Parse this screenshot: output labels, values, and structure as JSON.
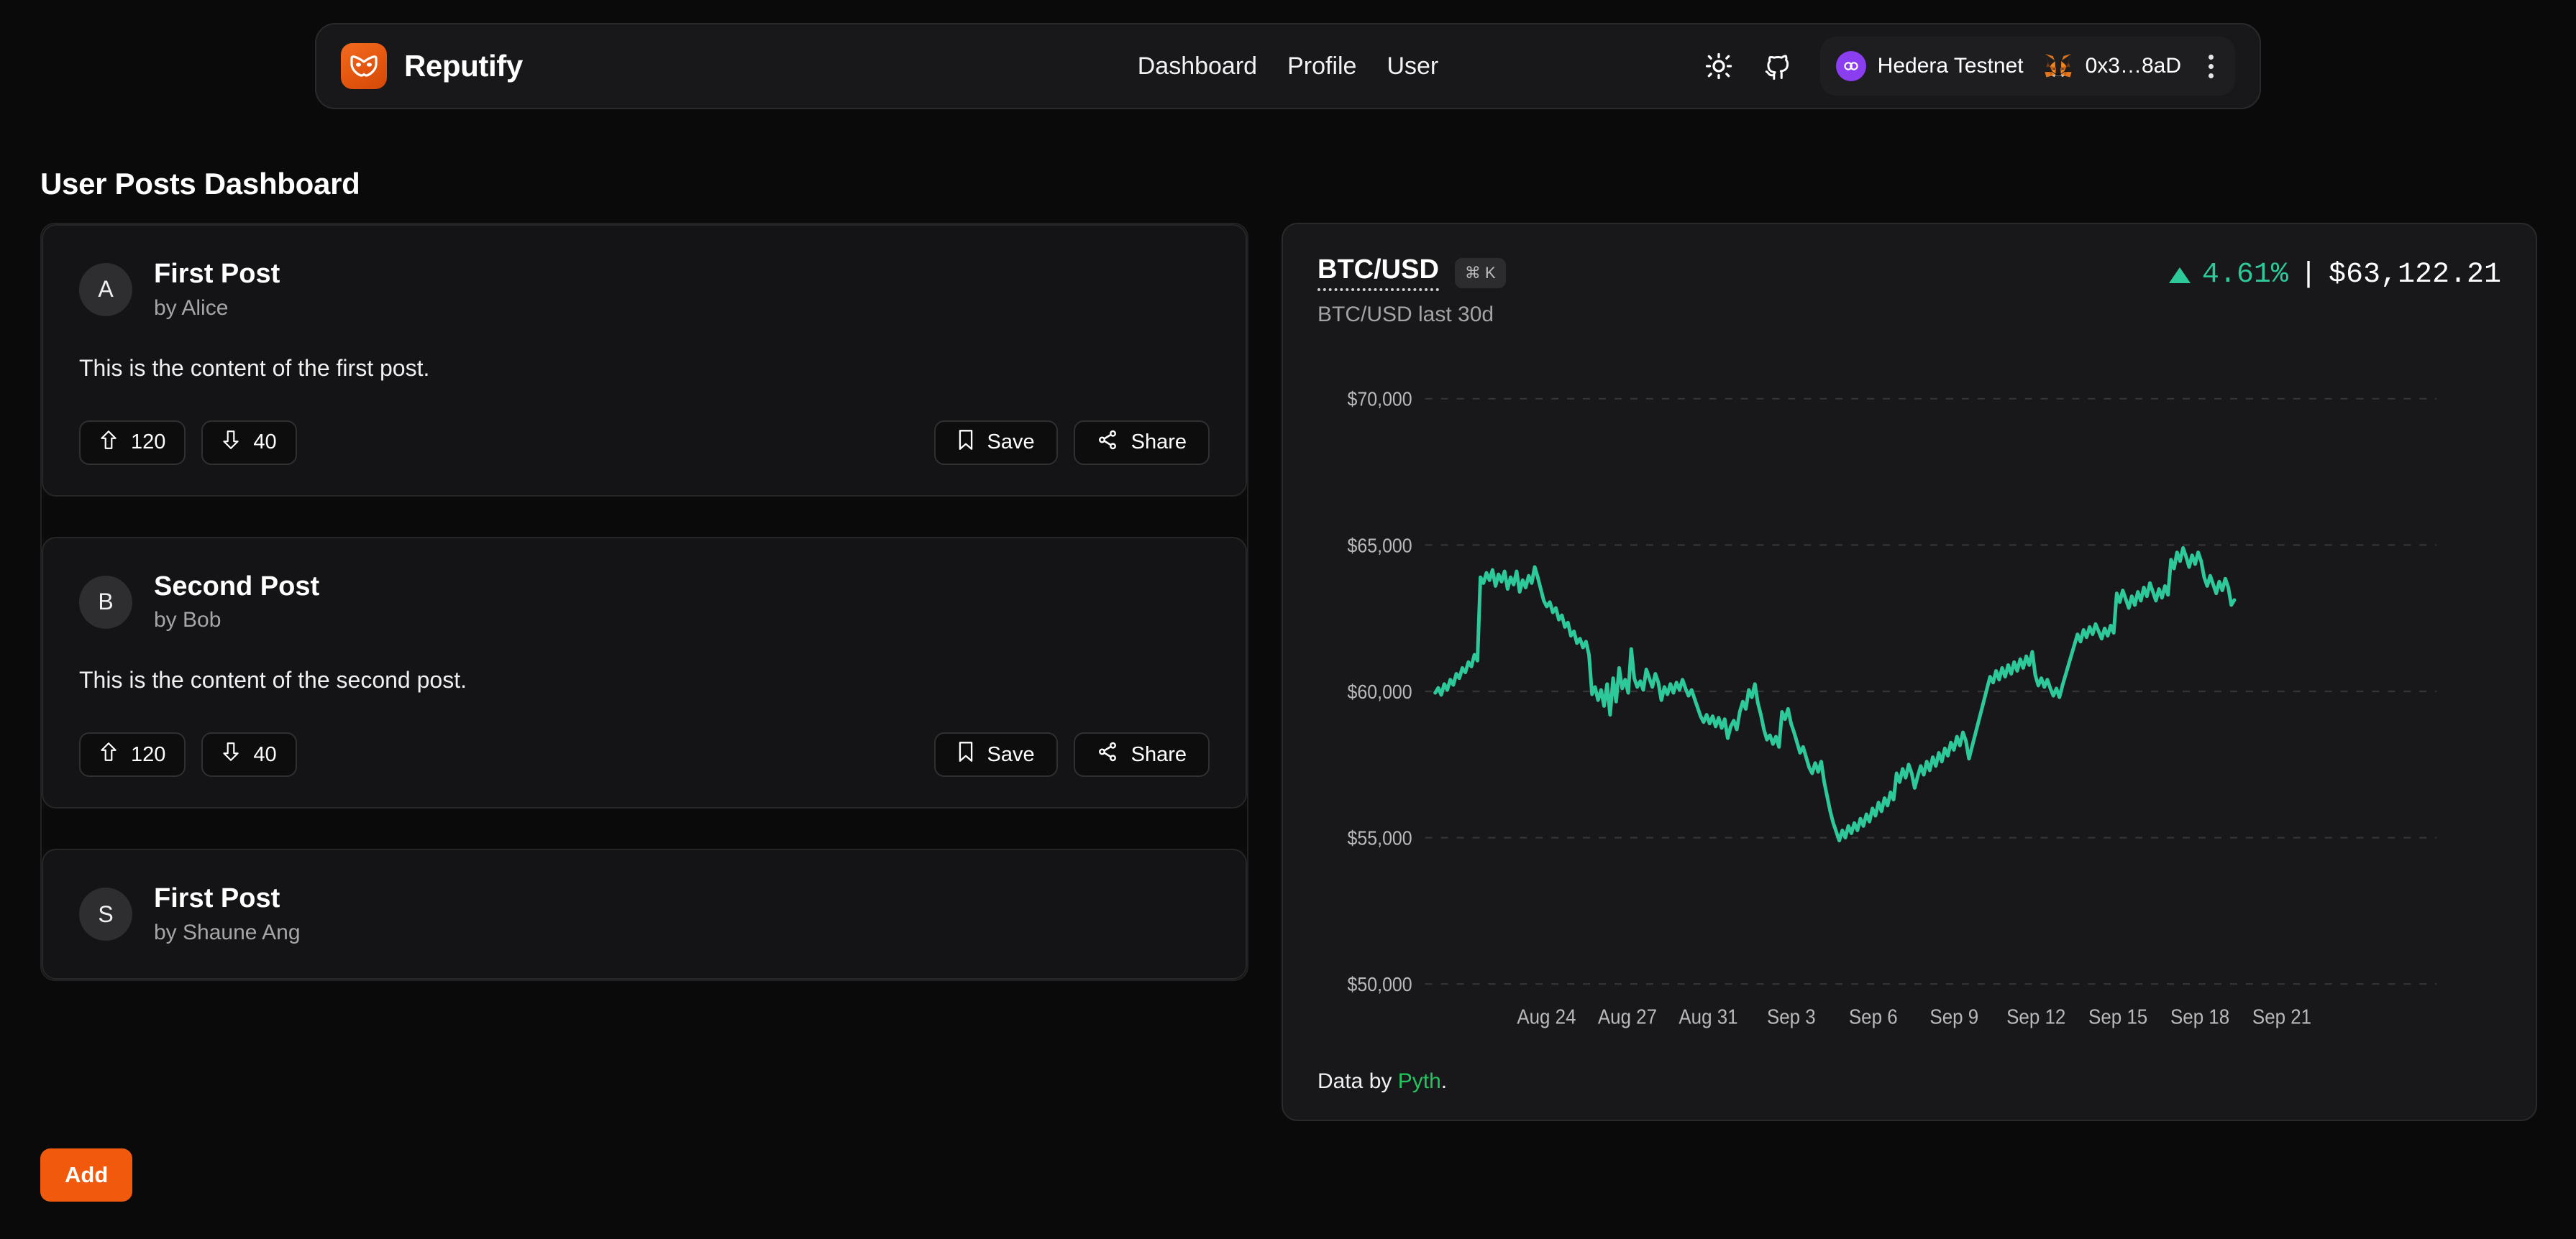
{
  "header": {
    "brand": "Reputify",
    "logo_icon": "mask-icon",
    "nav": [
      {
        "label": "Dashboard"
      },
      {
        "label": "Profile"
      },
      {
        "label": "User"
      }
    ],
    "theme_toggle_icon": "sun-icon",
    "github_icon": "github-icon",
    "network": {
      "label": "Hedera Testnet",
      "icon": "hedera-icon",
      "color": "#8b3df0"
    },
    "wallet": {
      "label": "0x3…8aD",
      "icon": "metamask-fox-icon"
    },
    "menu_icon": "kebab-menu-icon"
  },
  "main": {
    "title": "User Posts Dashboard",
    "add_button": "Add",
    "posts": [
      {
        "avatar": "A",
        "title": "First Post",
        "author": "by Alice",
        "content": "This is the content of the first post.",
        "upvotes": "120",
        "downvotes": "40",
        "save_label": "Save",
        "share_label": "Share"
      },
      {
        "avatar": "B",
        "title": "Second Post",
        "author": "by Bob",
        "content": "This is the content of the second post.",
        "upvotes": "120",
        "downvotes": "40",
        "save_label": "Save",
        "share_label": "Share"
      },
      {
        "avatar": "S",
        "title": "First Post",
        "author": "by Shaune Ang"
      }
    ]
  },
  "chart_panel": {
    "symbol": "BTC/USD",
    "shortcut": "⌘ K",
    "subtitle": "BTC/USD last 30d",
    "change_pct": "4.61%",
    "separator": "|",
    "price": "$63,122.21",
    "footer_prefix": "Data by ",
    "footer_link": "Pyth",
    "footer_suffix": ".",
    "up_color": "#2ec99a",
    "link_color": "#22c55e"
  },
  "chart_data": {
    "type": "line",
    "title": "BTC/USD last 30d",
    "xlabel": "",
    "ylabel": "",
    "ylim": [
      50000,
      71000
    ],
    "grid": true,
    "legend": false,
    "line_color": "#2ec99a",
    "ytick_labels": [
      "$70,000",
      "$65,000",
      "$60,000",
      "$55,000",
      "$50,000"
    ],
    "ytick_values": [
      70000,
      65000,
      60000,
      55000,
      50000
    ],
    "xtick_labels": [
      "Aug 24",
      "Aug 27",
      "Aug 31",
      "Sep 3",
      "Sep 6",
      "Sep 9",
      "Sep 12",
      "Sep 15",
      "Sep 18",
      "Sep 21"
    ],
    "xtick_positions": [
      0.035,
      0.115,
      0.195,
      0.277,
      0.358,
      0.438,
      0.519,
      0.6,
      0.681,
      0.762
    ],
    "series": [
      {
        "name": "BTC/USD",
        "values": [
          59950,
          60120,
          59880,
          60250,
          60050,
          60400,
          60220,
          60600,
          60450,
          60800,
          60650,
          61000,
          60850,
          61250,
          61050,
          63900,
          63700,
          64050,
          63800,
          64150,
          63600,
          64000,
          63750,
          64100,
          63500,
          63900,
          63650,
          64100,
          63400,
          63800,
          63550,
          63950,
          63700,
          64250,
          63900,
          63500,
          63100,
          62900,
          63050,
          62700,
          62850,
          62450,
          62600,
          62200,
          62350,
          61900,
          62050,
          61650,
          61800,
          61500,
          61700,
          61250,
          59900,
          60150,
          59700,
          60050,
          59500,
          60250,
          59200,
          60450,
          59650,
          60800,
          60100,
          60400,
          59950,
          61450,
          60450,
          60150,
          60350,
          60050,
          60750,
          60450,
          60150,
          60600,
          60300,
          59700,
          60150,
          59900,
          60250,
          59950,
          60300,
          60050,
          60400,
          60100,
          59850,
          60050,
          59750,
          59450,
          59150,
          58950,
          59200,
          58900,
          59150,
          58800,
          59100,
          58750,
          59050,
          58400,
          58800,
          59000,
          58700,
          59300,
          59650,
          59400,
          60050,
          59800,
          60250,
          59600,
          59200,
          58700,
          58350,
          58500,
          58200,
          58450,
          58100,
          59300,
          59050,
          59400,
          58900,
          58600,
          58250,
          57900,
          58100,
          57750,
          57400,
          57200,
          57550,
          57250,
          57600,
          56900,
          56400,
          55900,
          55500,
          55200,
          54900,
          55250,
          55000,
          55400,
          55150,
          55500,
          55250,
          55650,
          55400,
          55800,
          55550,
          56000,
          55750,
          56200,
          55900,
          56350,
          56100,
          56550,
          56300,
          57200,
          56900,
          57350,
          57050,
          57500,
          57200,
          56700,
          57100,
          57450,
          57150,
          57600,
          57300,
          57750,
          57450,
          57900,
          57600,
          58050,
          57800,
          58250,
          58000,
          58450,
          58150,
          58600,
          58300,
          57700,
          58100,
          58500,
          58900,
          59300,
          59700,
          60100,
          60500,
          60300,
          60700,
          60400,
          60800,
          60500,
          60900,
          60600,
          61000,
          60700,
          61100,
          60800,
          61200,
          60900,
          61350,
          60550,
          60200,
          60450,
          60150,
          60400,
          60100,
          59850,
          60100,
          59800,
          60200,
          60550,
          60900,
          61250,
          61600,
          61950,
          61700,
          62100,
          61850,
          62200,
          61950,
          62300,
          62050,
          61800,
          62150,
          61900,
          62250,
          62000,
          63350,
          63050,
          63450,
          63150,
          62850,
          63250,
          62950,
          63400,
          63100,
          63550,
          63250,
          63700,
          63400,
          63100,
          63500,
          63200,
          63600,
          63300,
          64500,
          64200,
          64750,
          64450,
          64900,
          64600,
          64250,
          64650,
          64350,
          64750,
          64450,
          63900,
          63600,
          63950,
          63650,
          63350,
          63750,
          63450,
          63850,
          63550,
          62950,
          63122
        ]
      }
    ]
  }
}
